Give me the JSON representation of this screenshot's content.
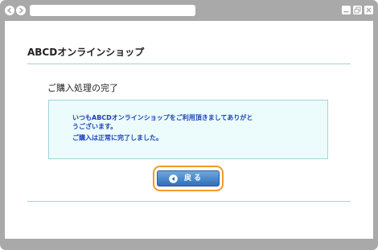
{
  "window": {
    "nav_back_icon": "back-arrow-icon",
    "nav_forward_icon": "forward-arrow-icon",
    "controls": [
      "minimize-icon",
      "maximize-icon",
      "close-icon"
    ],
    "frame_color": "#a9a9a9"
  },
  "page": {
    "shop_title": "ABCDオンラインショップ",
    "section_heading": "ご購入処理の完了",
    "message": {
      "line1": "いつもABCDオンラインショップをご利用頂きましてありがと",
      "line2": "うございます。",
      "line3": "ご購入は正常に完了しました。"
    },
    "back_button": {
      "label": "戻る",
      "icon": "left-triangle-icon",
      "color": "#2f6fb8",
      "focus_ring_color": "#f39a2a"
    },
    "accent_color": "#9fd4dc",
    "message_text_color": "#1a3fb8"
  }
}
